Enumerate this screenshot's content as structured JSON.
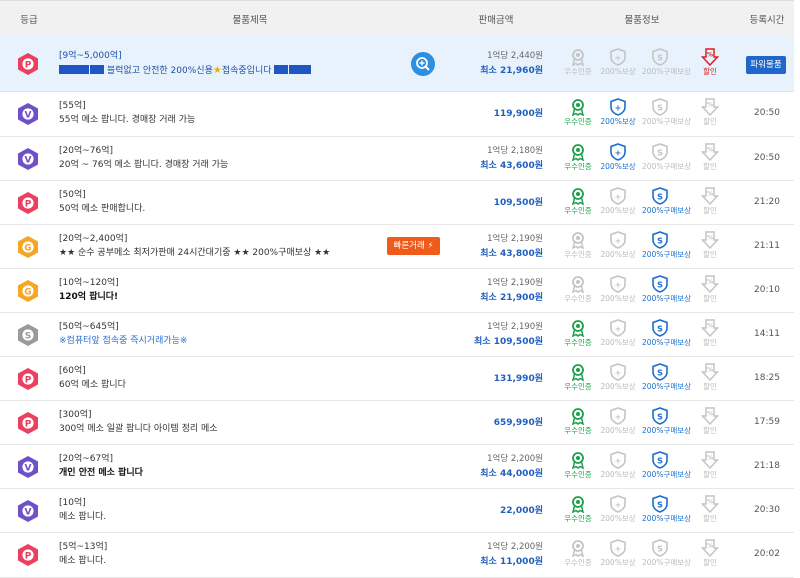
{
  "header": {
    "grade": "등급",
    "title": "물품제목",
    "price": "판매금액",
    "info": "물품정보",
    "time": "등록시간"
  },
  "labels": {
    "verified": "우수인증",
    "compensation": "200%보상",
    "purchase_comp": "200%구매보상",
    "discount": "할인",
    "min_prefix": "최소",
    "fast_trade": "빠른거래",
    "power_item": "파워물품"
  },
  "colors": {
    "grade_p": "#ec4060",
    "grade_v": "#7050c8",
    "grade_g": "#f5a623",
    "grade_s": "#9a9a9a",
    "active_green": "#1aa14a",
    "active_blue": "#1a6fd1",
    "active_red": "#d92020",
    "inactive": "#c4c4c4"
  },
  "rows": [
    {
      "grade": "P",
      "range": "[9억~5,000억]",
      "title": "블럭없고 안전한 200%신용",
      "title_tail": "접속중입니다",
      "unit": "1억당 2,440원",
      "price": "최소 21,960원",
      "time": ""
    },
    {
      "grade": "V",
      "range": "[55억]",
      "title": "55억 메소 팝니다. 경매장 거래 가능",
      "unit": "",
      "price": "119,900원",
      "time": "20:50"
    },
    {
      "grade": "V",
      "range": "[20억~76억]",
      "title": "20억 ~ 76억 메소 팝니다. 경매장 거래 가능",
      "unit": "1억당 2,180원",
      "price": "최소 43,600원",
      "time": "20:50"
    },
    {
      "grade": "P",
      "range": "[50억]",
      "title": "50억 메소 판매합니다.",
      "unit": "",
      "price": "109,500원",
      "time": "21:20"
    },
    {
      "grade": "G",
      "range": "[20억~2,400억]",
      "title": "★★ 순수 공부메소 최저가판매 24시간대기중 ★★ 200%구매보상 ★★",
      "unit": "1억당 2,190원",
      "price": "최소 43,800원",
      "time": "21:11"
    },
    {
      "grade": "G",
      "range": "[10억~120억]",
      "title": "120억 팝니다!",
      "unit": "1억당 2,190원",
      "price": "최소 21,900원",
      "time": "20:10"
    },
    {
      "grade": "S",
      "range": "[50억~645억]",
      "title": "※컴퓨터앞 접속중 즉시거래가능※",
      "unit": "1억당 2,190원",
      "price": "최소 109,500원",
      "time": "14:11"
    },
    {
      "grade": "P",
      "range": "[60억]",
      "title": "60억 메소 팝니다",
      "unit": "",
      "price": "131,990원",
      "time": "18:25"
    },
    {
      "grade": "P",
      "range": "[300억]",
      "title": "300억 메소 일괄 팝니다 아이템 정리 메소",
      "unit": "",
      "price": "659,990원",
      "time": "17:59"
    },
    {
      "grade": "V",
      "range": "[20억~67억]",
      "title": "개인 안전 메소 팝니다",
      "unit": "1억당 2,200원",
      "price": "최소 44,000원",
      "time": "21:18"
    },
    {
      "grade": "V",
      "range": "[10억]",
      "title": "메소 팝니다.",
      "unit": "",
      "price": "22,000원",
      "time": "20:30"
    },
    {
      "grade": "P",
      "range": "[5억~13억]",
      "title": "메소 팝니다.",
      "unit": "1억당 2,200원",
      "price": "최소 11,000원",
      "time": "20:02"
    }
  ]
}
